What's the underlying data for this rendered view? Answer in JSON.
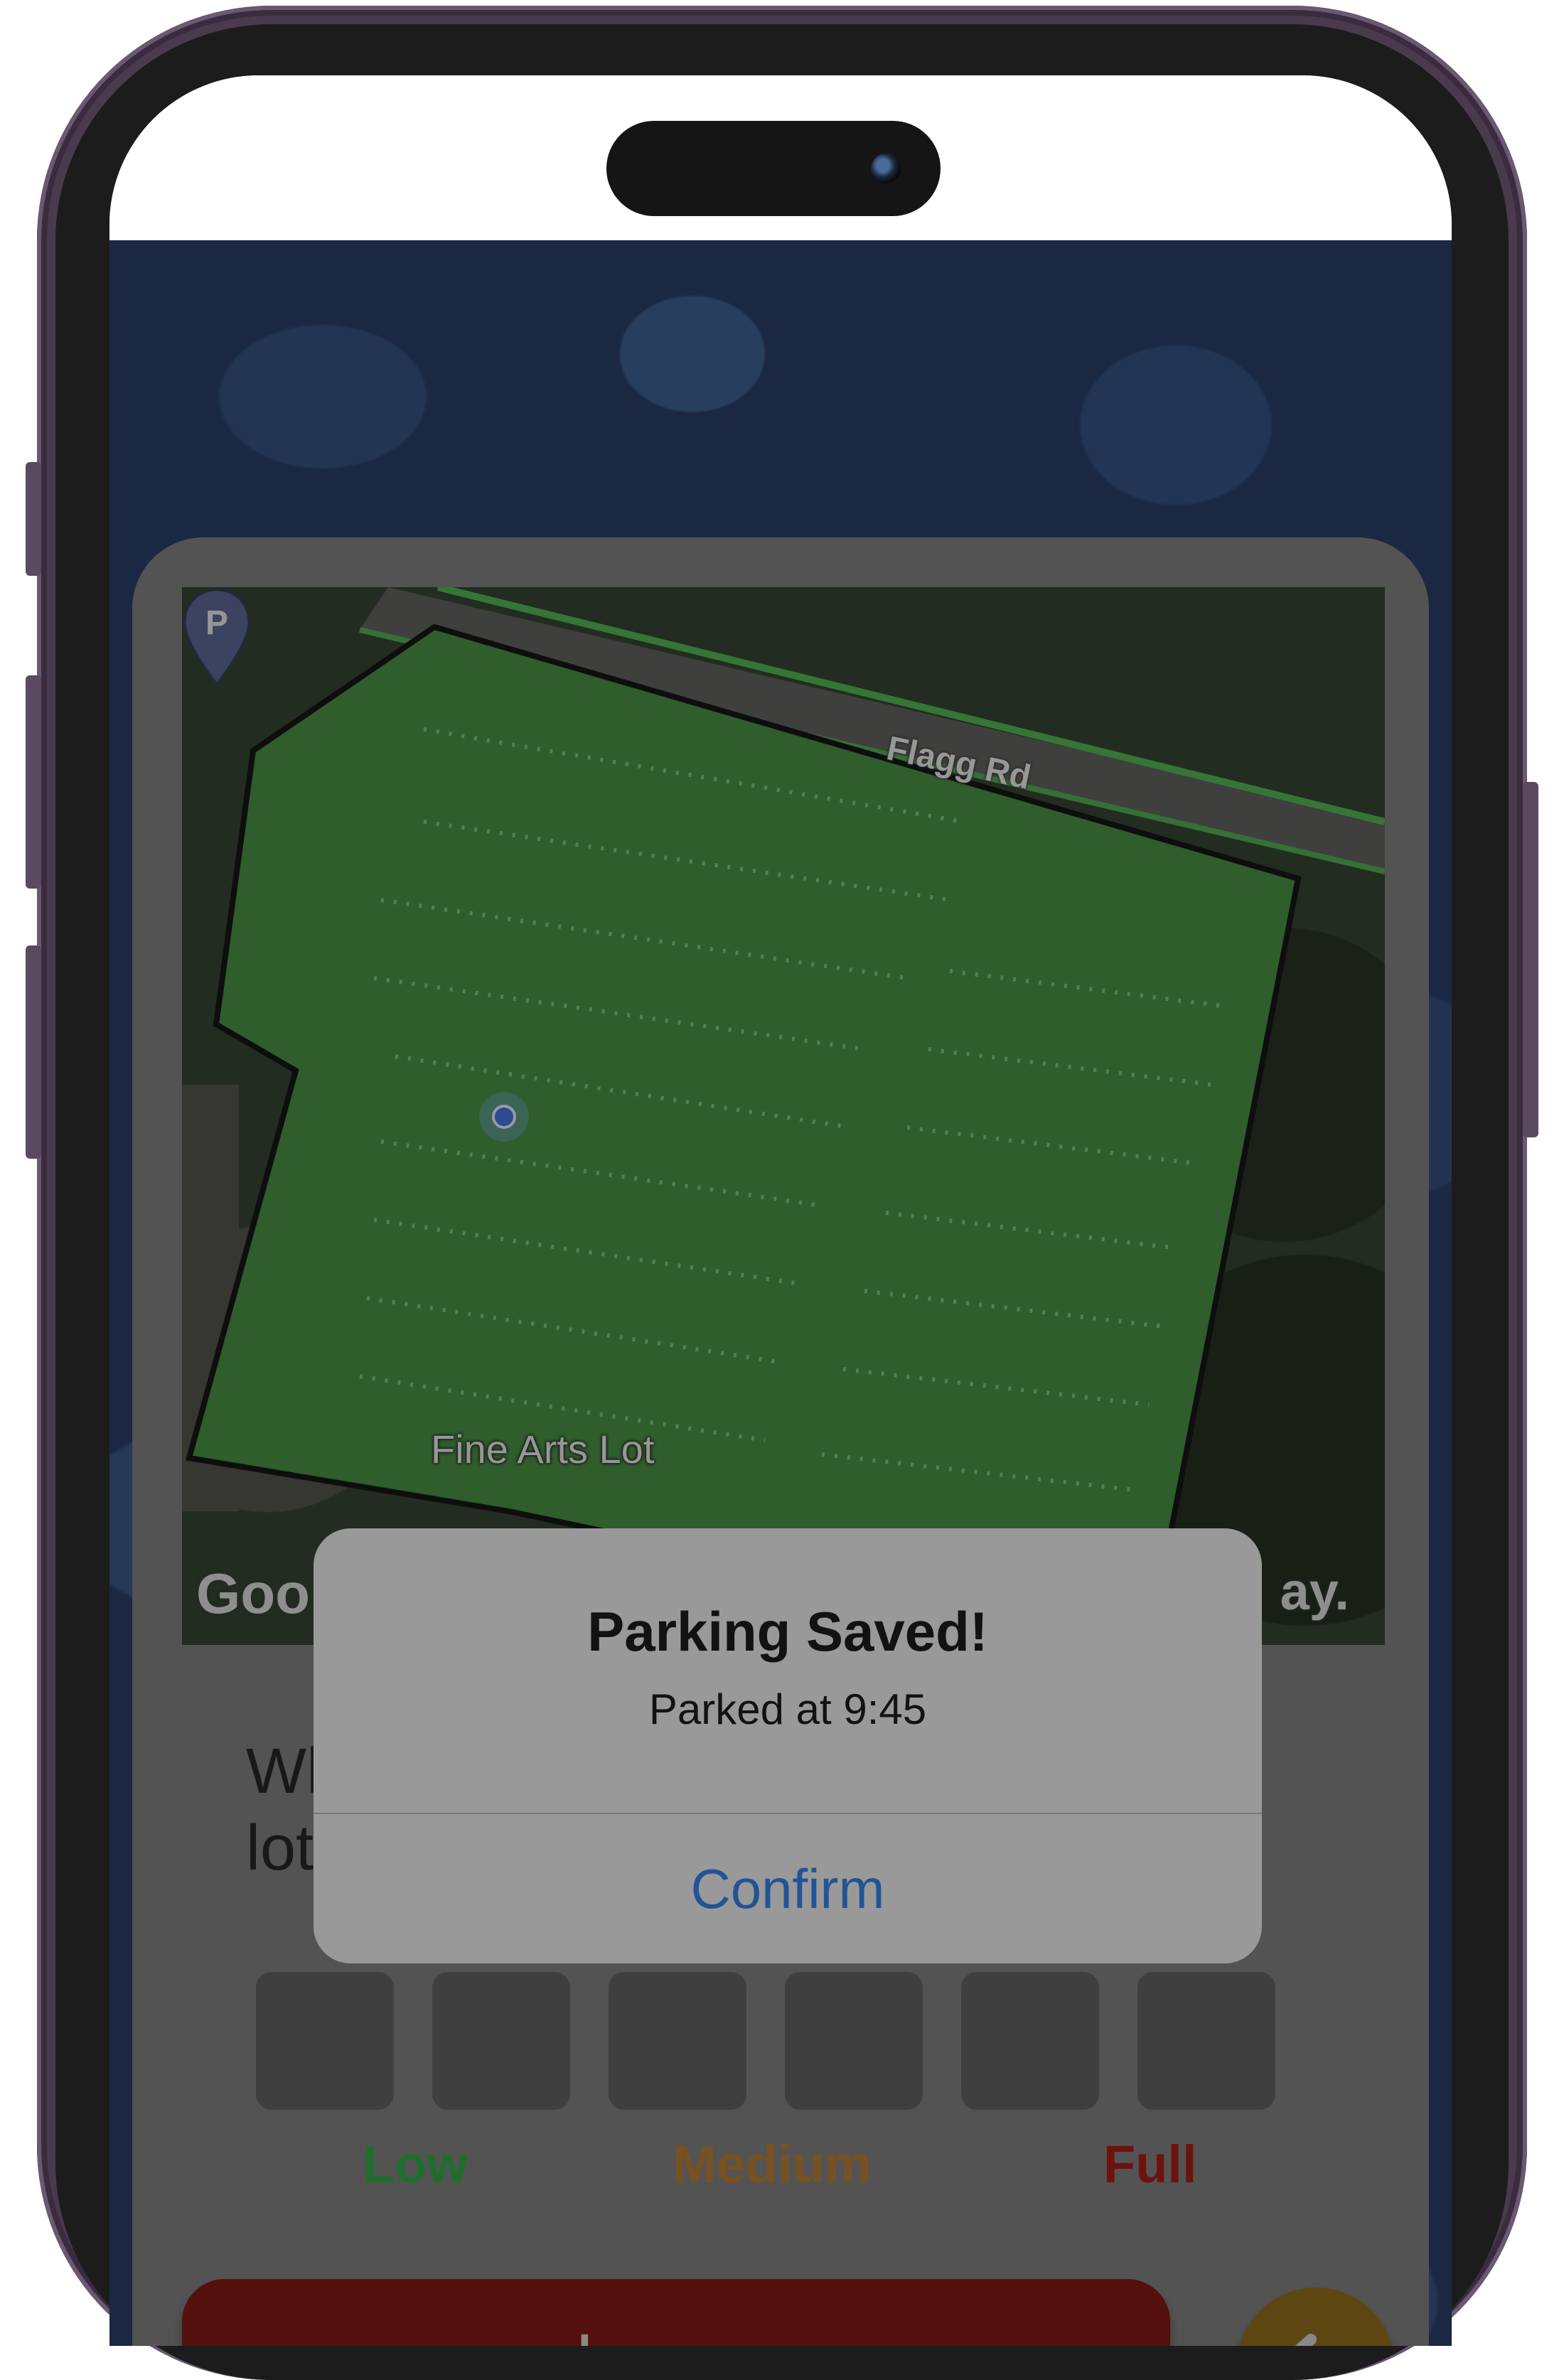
{
  "map": {
    "road_label": "Flagg Rd",
    "lot_label": "Fine Arts Lot",
    "pin_letter": "P",
    "attribution_left": "Goo",
    "attribution_right": "ay."
  },
  "question": {
    "line1": "Wh",
    "line2": "lot"
  },
  "meter": {
    "labels": [
      {
        "text": "Low",
        "color": "#27a53a"
      },
      {
        "text": "Medium",
        "color": "#b5772a"
      },
      {
        "text": "Full",
        "color": "#a3120a"
      }
    ],
    "boxes": 6
  },
  "actions": {
    "leave_label": "Leave",
    "back_icon": "undo-arrow-icon"
  },
  "alert": {
    "title": "Parking Saved!",
    "message": "Parked at 9:45",
    "confirm_label": "Confirm"
  },
  "colors": {
    "lot_overlay": "#3f8a3a",
    "leave_button": "#7a0d08",
    "back_button": "#8a6510",
    "alert_button_text": "#2a7be4"
  }
}
